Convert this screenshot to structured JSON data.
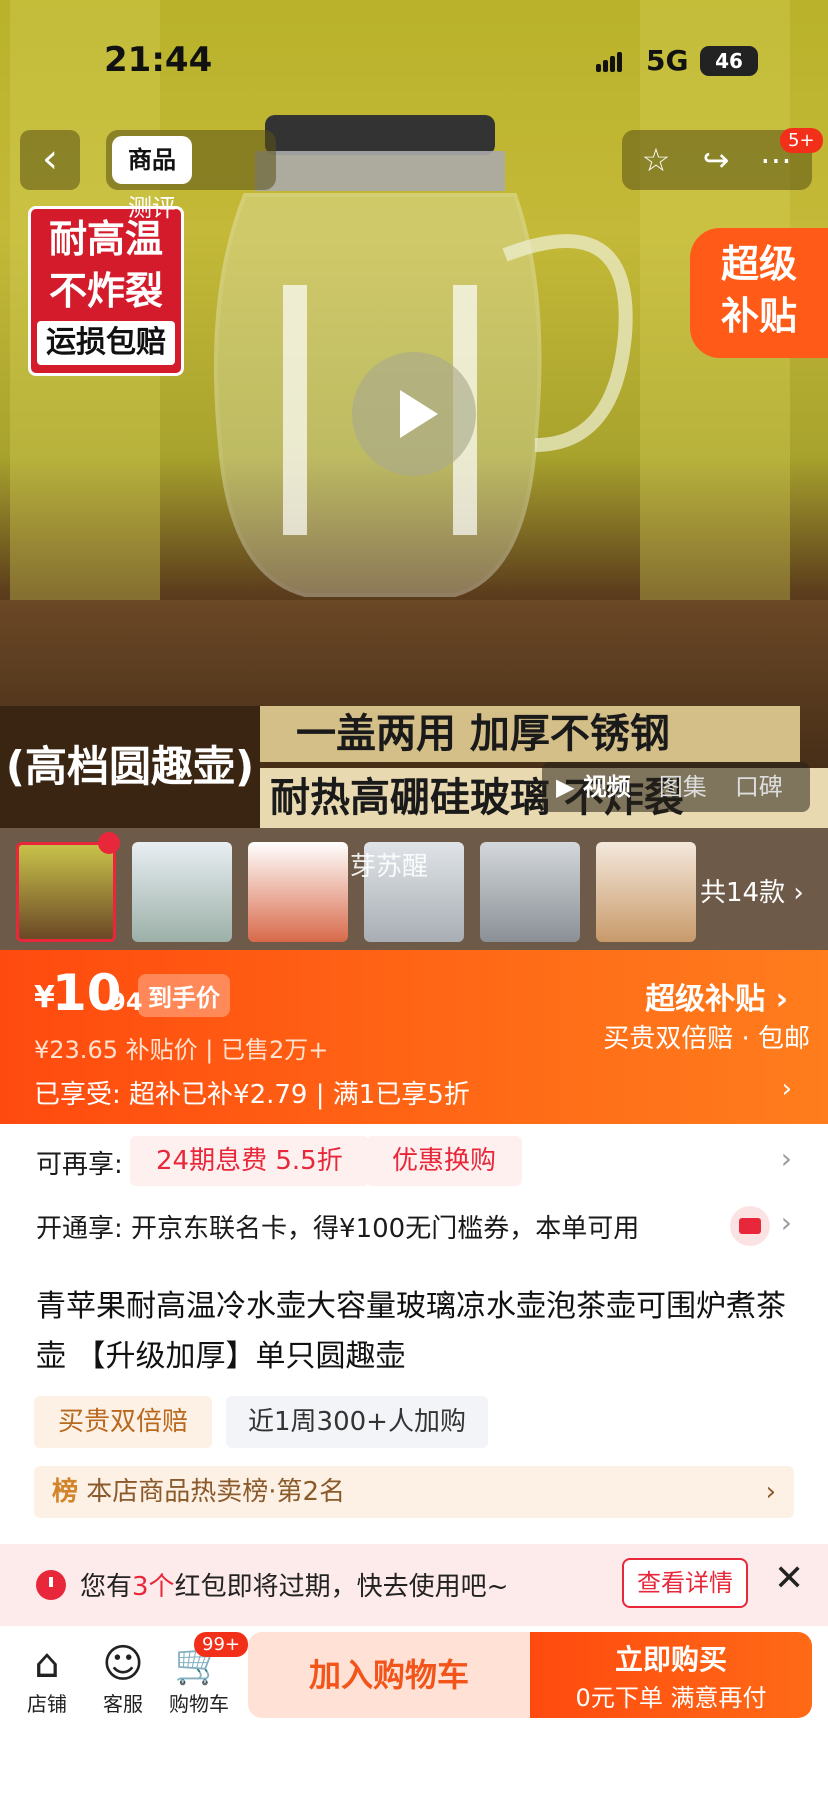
{
  "status_bar": {
    "time": "21:44",
    "network": "5G",
    "battery": "46"
  },
  "nav": {
    "tabs": [
      "商品",
      "测评"
    ],
    "more_badge": "5+"
  },
  "hero": {
    "sticker_lines": [
      "耐高温",
      "不炸裂"
    ],
    "sticker_sub": "运损包赔",
    "corner_badge": [
      "超级",
      "补贴"
    ],
    "banner_left": "(高档圆趣壶)",
    "banner_top": "一盖两用 加厚不锈钢",
    "banner_bottom": "耐热高硼硅玻璃 不炸裂",
    "media_tabs": [
      "▶ 视频",
      "图集",
      "口碑"
    ]
  },
  "thumbs": {
    "overlay_name": "芽苏醒",
    "more": "共14款 ›"
  },
  "price": {
    "currency": "¥",
    "integer": "10",
    "decimal": ".94",
    "final_label": "到手价",
    "subsidy_price": "¥23.65  补贴价",
    "sold": "已售2万+",
    "enjoyed": "已享受: 超补已补¥2.79 | 满1已享5折",
    "super_subsidy": "超级补贴 ›",
    "super_sub": "买贵双倍赔 · 包邮"
  },
  "offers": {
    "label": "可再享:",
    "pill1": "24期息费 5.5折",
    "pill2": "优惠换购",
    "card_text": "开通享: 开京东联名卡，得¥100无门槛券，本单可用"
  },
  "product": {
    "title": "青苹果耐高温冷水壶大容量玻璃凉水壶泡茶壶可围炉煮茶壶 【升级加厚】单只圆趣壶",
    "tag1": "买贵双倍赔",
    "tag2": "近1周300+人加购",
    "rank_icon": "榜",
    "rank": " 本店商品热卖榜·第2名"
  },
  "coupon": {
    "prefix": "您有",
    "count": "3个",
    "suffix": "红包即将过期，快去使用吧~",
    "button": "查看详情"
  },
  "bottom": {
    "store": "店铺",
    "service": "客服",
    "cart": "购物车",
    "cart_badge": "99+",
    "add_cart": "加入购物车",
    "buy_now": "立即购买",
    "buy_sub": "0元下单 满意再付"
  }
}
